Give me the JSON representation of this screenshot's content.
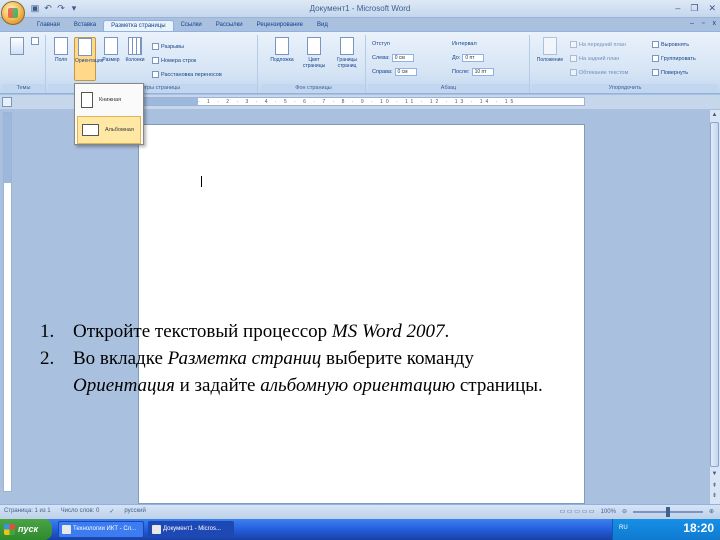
{
  "window": {
    "title": "Документ1 - Microsoft Word"
  },
  "ribbon_tabs": [
    "Главная",
    "Вставка",
    "Разметка страницы",
    "Ссылки",
    "Рассылки",
    "Рецензирование",
    "Вид"
  ],
  "active_tab": "Разметка страницы",
  "groups": {
    "themes": "Темы",
    "page_setup": "Параметры страницы",
    "page_background": "Фон страницы",
    "paragraph": "Абзац",
    "arrange": "Упорядочить"
  },
  "page_setup_buttons": {
    "fields": "Поля",
    "orientation": "Ориентация",
    "size": "Размер",
    "columns": "Колонки",
    "breaks": "Разрывы",
    "line_numbers": "Номера строк",
    "hyphenation": "Расстановка переносов"
  },
  "background_buttons": {
    "watermark": "Подложка",
    "page_color": "Цвет страницы",
    "page_borders": "Границы страниц"
  },
  "paragraph": {
    "indent_label": "Отступ",
    "spacing_label": "Интервал",
    "left_label": "Слева:",
    "left_value": "0 см",
    "right_label": "Справа:",
    "right_value": "0 см",
    "before_label": "До:",
    "before_value": "0 пт",
    "after_label": "После:",
    "after_value": "10 пт"
  },
  "arrange": {
    "position": "Положение",
    "front": "На передний план",
    "back": "На задний план",
    "wrap": "Обтекание текстом",
    "align": "Выровнять",
    "group": "Группировать",
    "rotate": "Повернуть"
  },
  "orientation_menu": {
    "portrait": "Книжная",
    "landscape": "Альбомная"
  },
  "instructions": {
    "item1_num": "1.",
    "item1_text": "Откройте текстовый процессор ",
    "item1_app": "MS Word 2007",
    "item1_end": ".",
    "item2_num": "2.",
    "item2_text_a": "Во вкладке ",
    "item2_tab": "Разметка страниц",
    "item2_text_b": " выберите команду",
    "item2_cmd": "Ориентация",
    "item2_text_c": " и задайте ",
    "item2_orient": "альбомную ориентацию",
    "item2_text_d": " страницы."
  },
  "statusbar": {
    "page": "Страница: 1 из 1",
    "words": "Число слов: 0",
    "language": "русский",
    "zoom": "100%"
  },
  "taskbar": {
    "start": "пуск",
    "task1": "Технологии ИКТ - Сл...",
    "task2": "Документ1 - Micros...",
    "lang": "RU",
    "time": "18:20"
  },
  "colors": {
    "ribbon_bg": "#d4e3f4",
    "accent": "#15428b",
    "taskbar": "#245edb",
    "start": "#3da93d"
  }
}
